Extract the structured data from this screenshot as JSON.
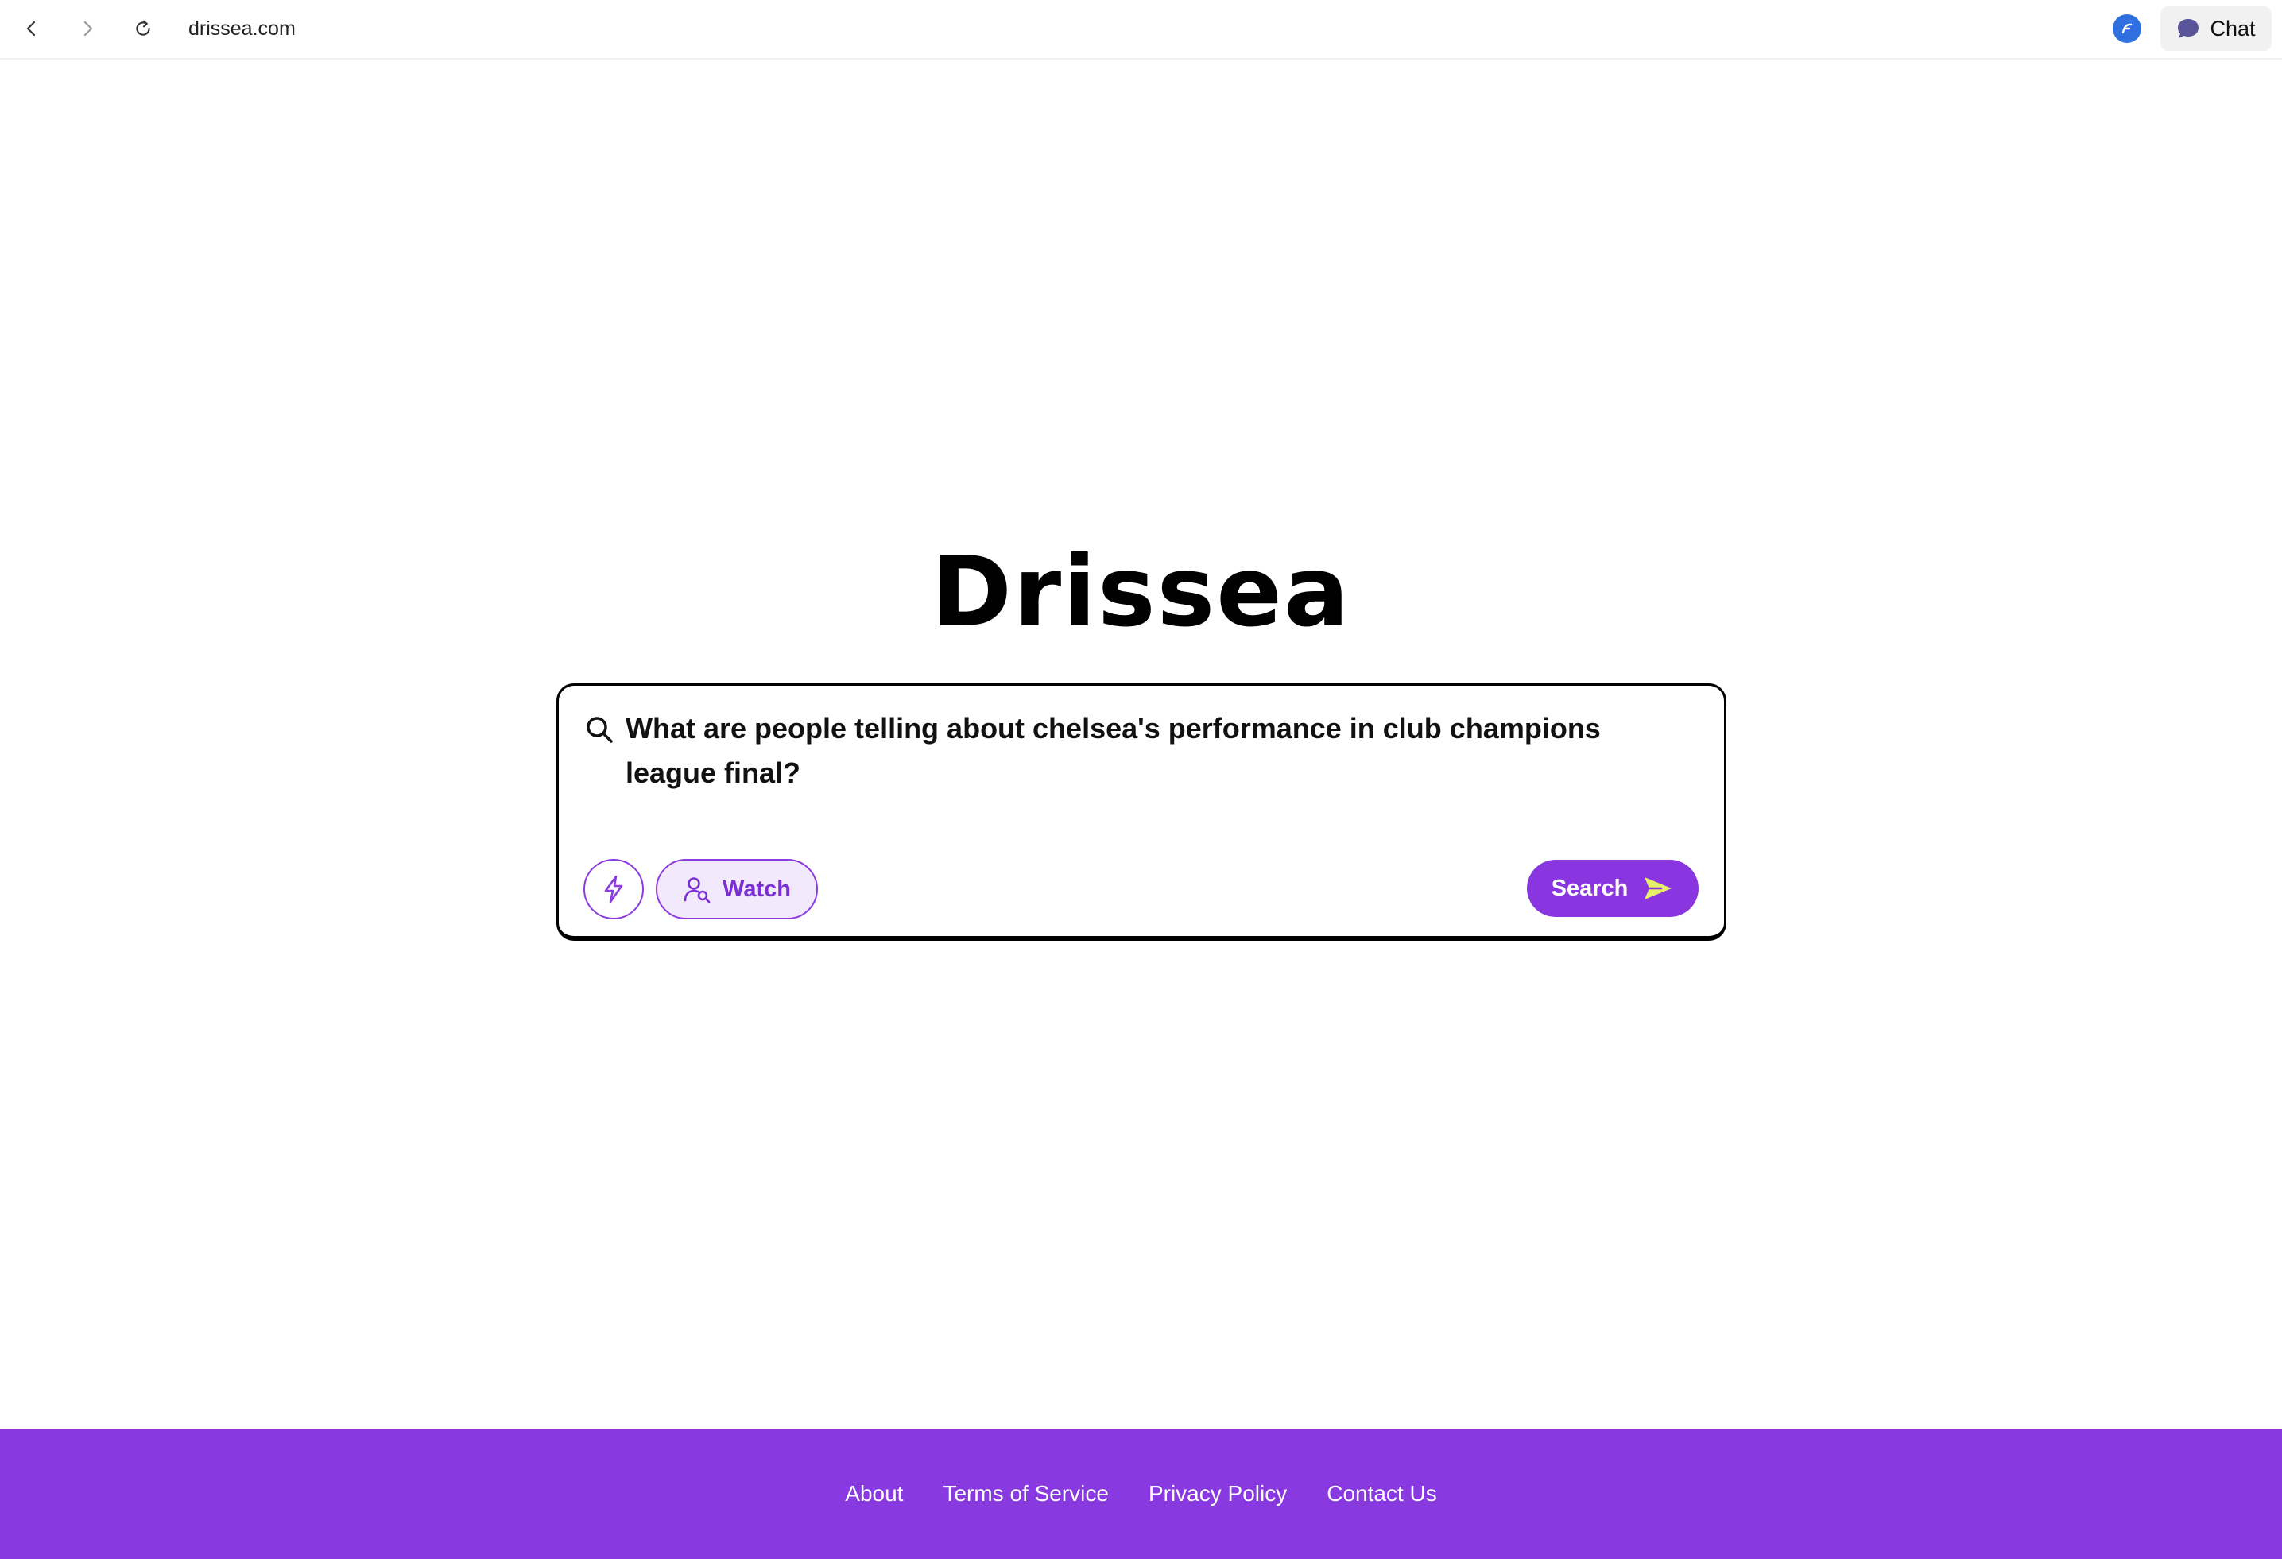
{
  "browser": {
    "url": "drissea.com",
    "chat_label": "Chat"
  },
  "logo": "Drissea",
  "search": {
    "query": "What are people telling about chelsea's performance in club champions league final?",
    "watch_label": "Watch",
    "submit_label": "Search"
  },
  "footer": {
    "links": [
      "About",
      "Terms of Service",
      "Privacy Policy",
      "Contact Us"
    ]
  },
  "colors": {
    "accent": "#8a36e0",
    "footer_bg": "#8839e0",
    "send_arrow": "#e6ef6a",
    "extension_icon": "#2f6fe0"
  },
  "icons": {
    "back": "chevron-left-icon",
    "forward": "chevron-right-icon",
    "reload": "reload-icon",
    "extension": "extension-logo-icon",
    "chat": "chat-bubble-icon",
    "search": "search-icon",
    "bolt": "lightning-bolt-icon",
    "watch": "user-search-icon",
    "send": "send-arrow-icon"
  }
}
